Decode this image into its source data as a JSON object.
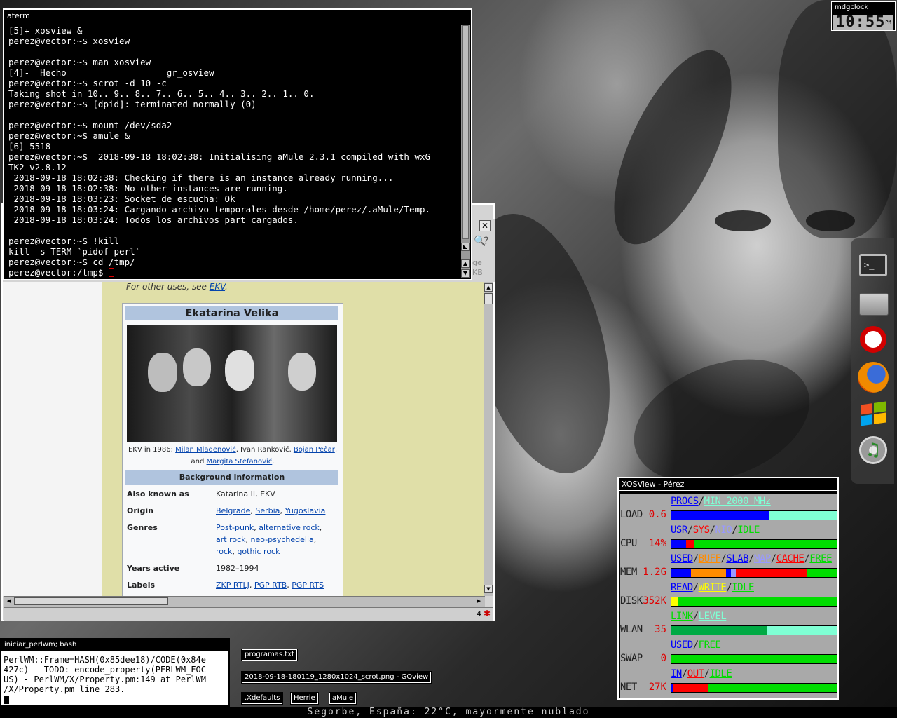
{
  "aterm": {
    "title": "aterm",
    "lines": [
      "[5]+ xosview &",
      "perez@vector:~$ xosview",
      "",
      "perez@vector:~$ man xosview",
      "[4]-  Hecho                   gr_osview",
      "perez@vector:~$ scrot -d 10 -c",
      "Taking shot in 10.. 9.. 8.. 7.. 6.. 5.. 4.. 3.. 2.. 1.. 0.",
      "perez@vector:~$ [dpid]: terminated normally (0)",
      "",
      "perez@vector:~$ mount /dev/sda2",
      "perez@vector:~$ amule &",
      "[6] 5518",
      "perez@vector:~$  2018-09-18 18:02:38: Initialising aMule 2.3.1 compiled with wxG",
      "TK2 v2.8.12",
      " 2018-09-18 18:02:38: Checking if there is an instance already running...",
      " 2018-09-18 18:02:38: No other instances are running.",
      " 2018-09-18 18:03:23: Socket de escucha: Ok",
      " 2018-09-18 18:03:24: Cargando archivo temporales desde /home/perez/.aMule/Temp.",
      " 2018-09-18 18:03:24: Todos los archivos part cargados.",
      "",
      "perez@vector:~$ !kill",
      "kill -s TERM `pidof perl`",
      "perez@vector:~$ cd /tmp/",
      "perez@vector:/tmp$ "
    ]
  },
  "browser": {
    "hatnote_prefix": "For other uses, see ",
    "hatnote_link": "EKV",
    "hatnote_suffix": ".",
    "partial_right": "ge",
    "partial_kb": "KB",
    "status_count": "4",
    "infobox": {
      "title": "Ekatarina Velika",
      "caption_prefix": "EKV in 1986: ",
      "caption_link1": "Milan Mladenović",
      "caption_mid": ", Ivan Ranković, ",
      "caption_link2": "Bojan Pečar",
      "caption_comma": ",",
      "caption_and": "and ",
      "caption_link3": "Margita Stefanović",
      "caption_end": ".",
      "section": "Background information",
      "rows": [
        {
          "key": "Also known as",
          "value": "Katarina II, EKV"
        },
        {
          "key": "Origin",
          "links": [
            "Belgrade",
            "Serbia",
            "Yugoslavia"
          ]
        },
        {
          "key": "Genres",
          "links": [
            "Post-punk",
            "alternative rock",
            "art rock",
            "neo-psychedelia",
            "rock",
            "gothic rock"
          ]
        },
        {
          "key": "Years active",
          "value": "1982–1994"
        },
        {
          "key": "Labels",
          "links": [
            "ZKP RTLJ",
            "PGP RTB",
            "PGP RTS"
          ]
        }
      ]
    }
  },
  "mdgclock": {
    "title": "mdgclock",
    "time": "10:55",
    "ampm": "PM"
  },
  "dock": {
    "icons": [
      "terminal-icon",
      "folder-icon",
      "opera-icon",
      "firefox-icon",
      "windows-icon",
      "music-icon"
    ]
  },
  "xosview": {
    "title": "XOSView - Pérez",
    "meters": [
      {
        "name": "LOAD",
        "value": "0.6",
        "legend": [
          {
            "t": "PROCS",
            "c": "#0000ff"
          },
          {
            "t": "/",
            "c": "#222"
          },
          {
            "t": "MIN 2000 MHz",
            "c": "#7fffd4"
          }
        ],
        "segs": [
          {
            "f": 0.59,
            "c": "#0000ff"
          },
          {
            "f": 0.41,
            "c": "#7fffd4"
          }
        ]
      },
      {
        "name": "CPU",
        "value": "14%",
        "legend": [
          {
            "t": "USR",
            "c": "#0000ff"
          },
          {
            "t": "/",
            "c": "#222"
          },
          {
            "t": "SYS",
            "c": "#ff0000"
          },
          {
            "t": "/",
            "c": "#222"
          },
          {
            "t": "NIO",
            "c": "#9999ff"
          },
          {
            "t": "/",
            "c": "#222"
          },
          {
            "t": "IDLE",
            "c": "#00dd00"
          }
        ],
        "segs": [
          {
            "f": 0.09,
            "c": "#0000ff"
          },
          {
            "f": 0.05,
            "c": "#ff0000"
          },
          {
            "f": 0.86,
            "c": "#00dd00"
          }
        ]
      },
      {
        "name": "MEM",
        "value": "1.2G",
        "legend": [
          {
            "t": "USED",
            "c": "#0000ff"
          },
          {
            "t": "/",
            "c": "#222"
          },
          {
            "t": "BUFF",
            "c": "#ff8c00"
          },
          {
            "t": "/",
            "c": "#222"
          },
          {
            "t": "SLAB",
            "c": "#0000ff"
          },
          {
            "t": "/",
            "c": "#222"
          },
          {
            "t": "MAP",
            "c": "#9999ff"
          },
          {
            "t": "/",
            "c": "#222"
          },
          {
            "t": "CACHE",
            "c": "#ff0000"
          },
          {
            "t": "/",
            "c": "#222"
          },
          {
            "t": "FREE",
            "c": "#00dd00"
          }
        ],
        "segs": [
          {
            "f": 0.12,
            "c": "#0000ff"
          },
          {
            "f": 0.21,
            "c": "#ff8c00"
          },
          {
            "f": 0.03,
            "c": "#0000ff"
          },
          {
            "f": 0.03,
            "c": "#9999ff"
          },
          {
            "f": 0.43,
            "c": "#ff0000"
          },
          {
            "f": 0.18,
            "c": "#00dd00"
          }
        ]
      },
      {
        "name": "DISK",
        "value": "352K",
        "legend": [
          {
            "t": "READ",
            "c": "#0000ff"
          },
          {
            "t": "/",
            "c": "#222"
          },
          {
            "t": "WRITE",
            "c": "#ffff00"
          },
          {
            "t": "/",
            "c": "#222"
          },
          {
            "t": "IDLE",
            "c": "#00dd00"
          }
        ],
        "segs": [
          {
            "f": 0.04,
            "c": "#ffff00"
          },
          {
            "f": 0.96,
            "c": "#00dd00"
          }
        ]
      },
      {
        "name": "WLAN",
        "value": "35",
        "legend": [
          {
            "t": "LINK",
            "c": "#00dd00"
          },
          {
            "t": "/",
            "c": "#222"
          },
          {
            "t": "LEVEL",
            "c": "#7fffd4"
          }
        ],
        "segs": [
          {
            "f": 0.58,
            "c": "#00aa44"
          },
          {
            "f": 0.42,
            "c": "#7fffd4"
          }
        ]
      },
      {
        "name": "SWAP",
        "value": "0",
        "legend": [
          {
            "t": "USED",
            "c": "#0000ff"
          },
          {
            "t": "/",
            "c": "#222"
          },
          {
            "t": "FREE",
            "c": "#00dd00"
          }
        ],
        "segs": [
          {
            "f": 1.0,
            "c": "#00dd00"
          }
        ]
      },
      {
        "name": "NET",
        "value": "27K",
        "legend": [
          {
            "t": "IN",
            "c": "#0000ff"
          },
          {
            "t": "/",
            "c": "#222"
          },
          {
            "t": "OUT",
            "c": "#ff0000"
          },
          {
            "t": "/",
            "c": "#222"
          },
          {
            "t": "IDLE",
            "c": "#00dd00"
          }
        ],
        "segs": [
          {
            "f": 0.01,
            "c": "#0000ff"
          },
          {
            "f": 0.21,
            "c": "#ff0000"
          },
          {
            "f": 0.78,
            "c": "#00dd00"
          }
        ]
      }
    ]
  },
  "smallterm": {
    "title": "iniciar_perlwm; bash",
    "lines": [
      "PerlWM::Frame=HASH(0x85dee18)/CODE(0x84e",
      "427c) - TODO: encode_property(PERLWM_FOC",
      "US) - PerlWM/X/Property.pm:149 at PerlWM",
      "/X/Property.pm line 283."
    ]
  },
  "icons": {
    "programas": "programas.txt",
    "gqview": "2018-09-18-180119_1280x1024_scrot.png - GQview",
    "xdefaults": ".Xdefaults",
    "herrie": "Herrie",
    "amule": "aMule"
  },
  "statusline": "Segorbe, España: 22°C, mayormente nublado"
}
